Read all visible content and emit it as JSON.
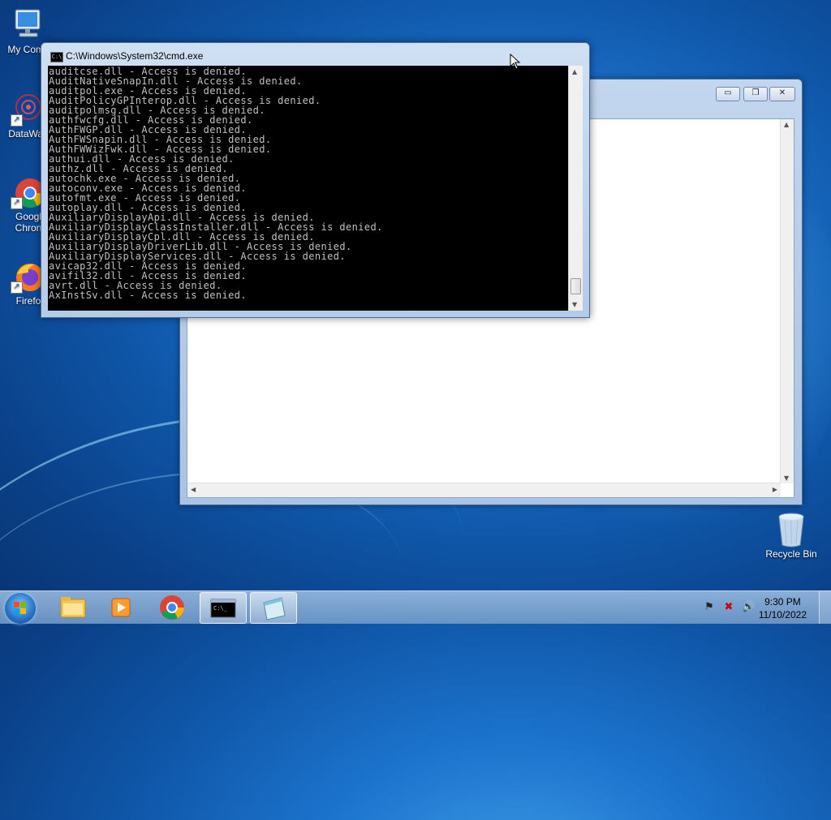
{
  "desktop": {
    "icons": [
      {
        "label": "My Comp",
        "icon": "computer-icon"
      },
      {
        "label": "DataWag",
        "icon": "datawag-icon"
      },
      {
        "label": "Googl",
        "label2": "Chron",
        "icon": "chrome-icon"
      },
      {
        "label": "Firefo",
        "icon": "firefox-icon"
      },
      {
        "label": "Recycle Bin",
        "icon": "recycle-bin-icon"
      }
    ]
  },
  "cmd": {
    "title": "C:\\Windows\\System32\\cmd.exe",
    "lines": [
      "auditcse.dll - Access is denied.",
      "AuditNativeSnapIn.dll - Access is denied.",
      "auditpol.exe - Access is denied.",
      "AuditPolicyGPInterop.dll - Access is denied.",
      "auditpolmsg.dll - Access is denied.",
      "authfwcfg.dll - Access is denied.",
      "AuthFWGP.dll - Access is denied.",
      "AuthFWSnapin.dll - Access is denied.",
      "AuthFWWizFwk.dll - Access is denied.",
      "authui.dll - Access is denied.",
      "authz.dll - Access is denied.",
      "autochk.exe - Access is denied.",
      "autoconv.exe - Access is denied.",
      "autofmt.exe - Access is denied.",
      "autoplay.dll - Access is denied.",
      "AuxiliaryDisplayApi.dll - Access is denied.",
      "AuxiliaryDisplayClassInstaller.dll - Access is denied.",
      "AuxiliaryDisplayCpl.dll - Access is denied.",
      "AuxiliaryDisplayDriverLib.dll - Access is denied.",
      "AuxiliaryDisplayServices.dll - Access is denied.",
      "avicap32.dll - Access is denied.",
      "avifil32.dll - Access is denied.",
      "avrt.dll - Access is denied.",
      "AxInstSv.dll - Access is denied."
    ]
  },
  "back_window": {
    "buttons": {
      "minimize": "▭",
      "maximize": "❐",
      "close": "✕"
    }
  },
  "taskbar": {
    "items": [
      "explorer-icon",
      "media-player-icon",
      "chrome-icon",
      "cmd-icon",
      "notepad-icon"
    ],
    "active": "cmd-icon",
    "time": "9:30 PM",
    "date": "11/10/2022"
  }
}
